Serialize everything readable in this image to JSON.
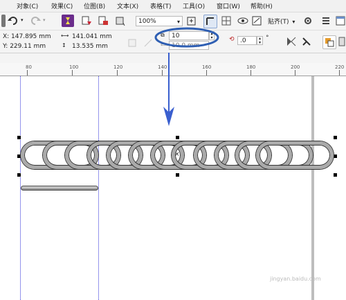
{
  "menu": [
    "对象(C)",
    "效果(C)",
    "位图(B)",
    "文本(X)",
    "表格(T)",
    "工具(O)",
    "窗口(W)",
    "帮助(H)"
  ],
  "toolbar": {
    "zoom": "100%",
    "snap_label": "贴齐(T)",
    "snap_arrow": "▾"
  },
  "props": {
    "x": "X: 147.895 mm",
    "y": "Y: 229.11 mm",
    "width": "141.041 mm",
    "height": "13.535 mm",
    "count": "10",
    "spacing": "10.0 mm",
    "angle": ".0",
    "angle_unit": "°"
  },
  "ruler": {
    "labels": [
      "80",
      "100",
      "120",
      "140",
      "160",
      "180",
      "200",
      "220"
    ]
  },
  "watermark": "jingyan.baidu.com",
  "colors": {
    "highlight": "#2f5fb3",
    "arrow": "#3a5fcf",
    "guide": "#2b2bd9"
  }
}
